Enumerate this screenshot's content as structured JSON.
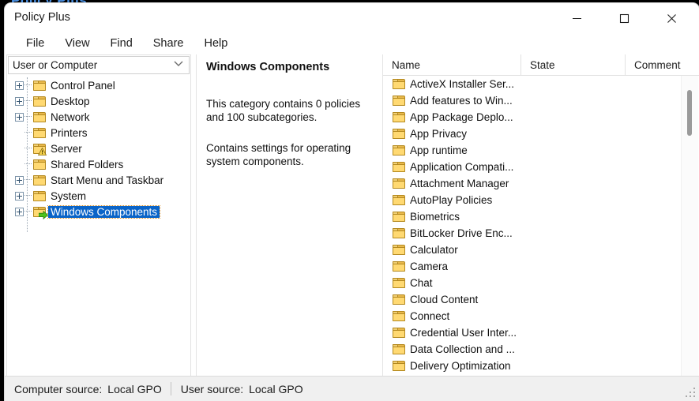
{
  "desktop": {
    "background_fragment_text": "Policy Plus"
  },
  "window": {
    "title": "Policy Plus",
    "controls": [
      {
        "name": "minimize",
        "glyph": "minimize-icon"
      },
      {
        "name": "maximize",
        "glyph": "maximize-icon"
      },
      {
        "name": "close",
        "glyph": "close-icon"
      }
    ]
  },
  "menubar": {
    "items": [
      {
        "label": "File"
      },
      {
        "label": "View"
      },
      {
        "label": "Find"
      },
      {
        "label": "Share"
      },
      {
        "label": "Help"
      }
    ]
  },
  "tree_pane": {
    "scope_selector": {
      "value": "User or Computer",
      "icon": "chevron-down-icon"
    },
    "nodes": [
      {
        "label": "Control Panel",
        "expandable": true,
        "icon": "folder-icon",
        "selected": false
      },
      {
        "label": "Desktop",
        "expandable": true,
        "icon": "folder-icon",
        "selected": false
      },
      {
        "label": "Network",
        "expandable": true,
        "icon": "folder-icon",
        "selected": false
      },
      {
        "label": "Printers",
        "expandable": false,
        "icon": "folder-icon",
        "selected": false
      },
      {
        "label": "Server",
        "expandable": false,
        "icon": "folder-warning-icon",
        "selected": false
      },
      {
        "label": "Shared Folders",
        "expandable": false,
        "icon": "folder-icon",
        "selected": false
      },
      {
        "label": "Start Menu and Taskbar",
        "expandable": true,
        "icon": "folder-icon",
        "selected": false
      },
      {
        "label": "System",
        "expandable": true,
        "icon": "folder-icon",
        "selected": false
      },
      {
        "label": "Windows Components",
        "expandable": true,
        "icon": "folder-arrow-icon",
        "selected": true
      }
    ]
  },
  "detail_pane": {
    "title": "Windows Components",
    "summary": "This category contains 0 policies and 100 subcategories.",
    "description": "Contains settings for operating system components.",
    "policy_count": 0,
    "subcategory_count": 100
  },
  "list_pane": {
    "columns": [
      {
        "label": "Name"
      },
      {
        "label": "State"
      },
      {
        "label": "Comment"
      }
    ],
    "rows": [
      {
        "name": "ActiveX Installer Ser...",
        "state": "",
        "comment": ""
      },
      {
        "name": "Add features to Win...",
        "state": "",
        "comment": ""
      },
      {
        "name": "App Package Deplo...",
        "state": "",
        "comment": ""
      },
      {
        "name": "App Privacy",
        "state": "",
        "comment": ""
      },
      {
        "name": "App runtime",
        "state": "",
        "comment": ""
      },
      {
        "name": "Application Compati...",
        "state": "",
        "comment": ""
      },
      {
        "name": "Attachment Manager",
        "state": "",
        "comment": ""
      },
      {
        "name": "AutoPlay Policies",
        "state": "",
        "comment": ""
      },
      {
        "name": "Biometrics",
        "state": "",
        "comment": ""
      },
      {
        "name": "BitLocker Drive Enc...",
        "state": "",
        "comment": ""
      },
      {
        "name": "Calculator",
        "state": "",
        "comment": ""
      },
      {
        "name": "Camera",
        "state": "",
        "comment": ""
      },
      {
        "name": "Chat",
        "state": "",
        "comment": ""
      },
      {
        "name": "Cloud Content",
        "state": "",
        "comment": ""
      },
      {
        "name": "Connect",
        "state": "",
        "comment": ""
      },
      {
        "name": "Credential User Inter...",
        "state": "",
        "comment": ""
      },
      {
        "name": "Data Collection and ...",
        "state": "",
        "comment": ""
      },
      {
        "name": "Delivery Optimization",
        "state": "",
        "comment": ""
      }
    ]
  },
  "statusbar": {
    "computer_source_label": "Computer source:",
    "computer_source_value": "Local GPO",
    "user_source_label": "User source:",
    "user_source_value": "Local GPO"
  },
  "colors": {
    "selection_blue": "#0a64c8",
    "focus_orange": "#d98b1e",
    "folder_yellow": "#ffd972",
    "status_bg": "#f0f0f0"
  }
}
